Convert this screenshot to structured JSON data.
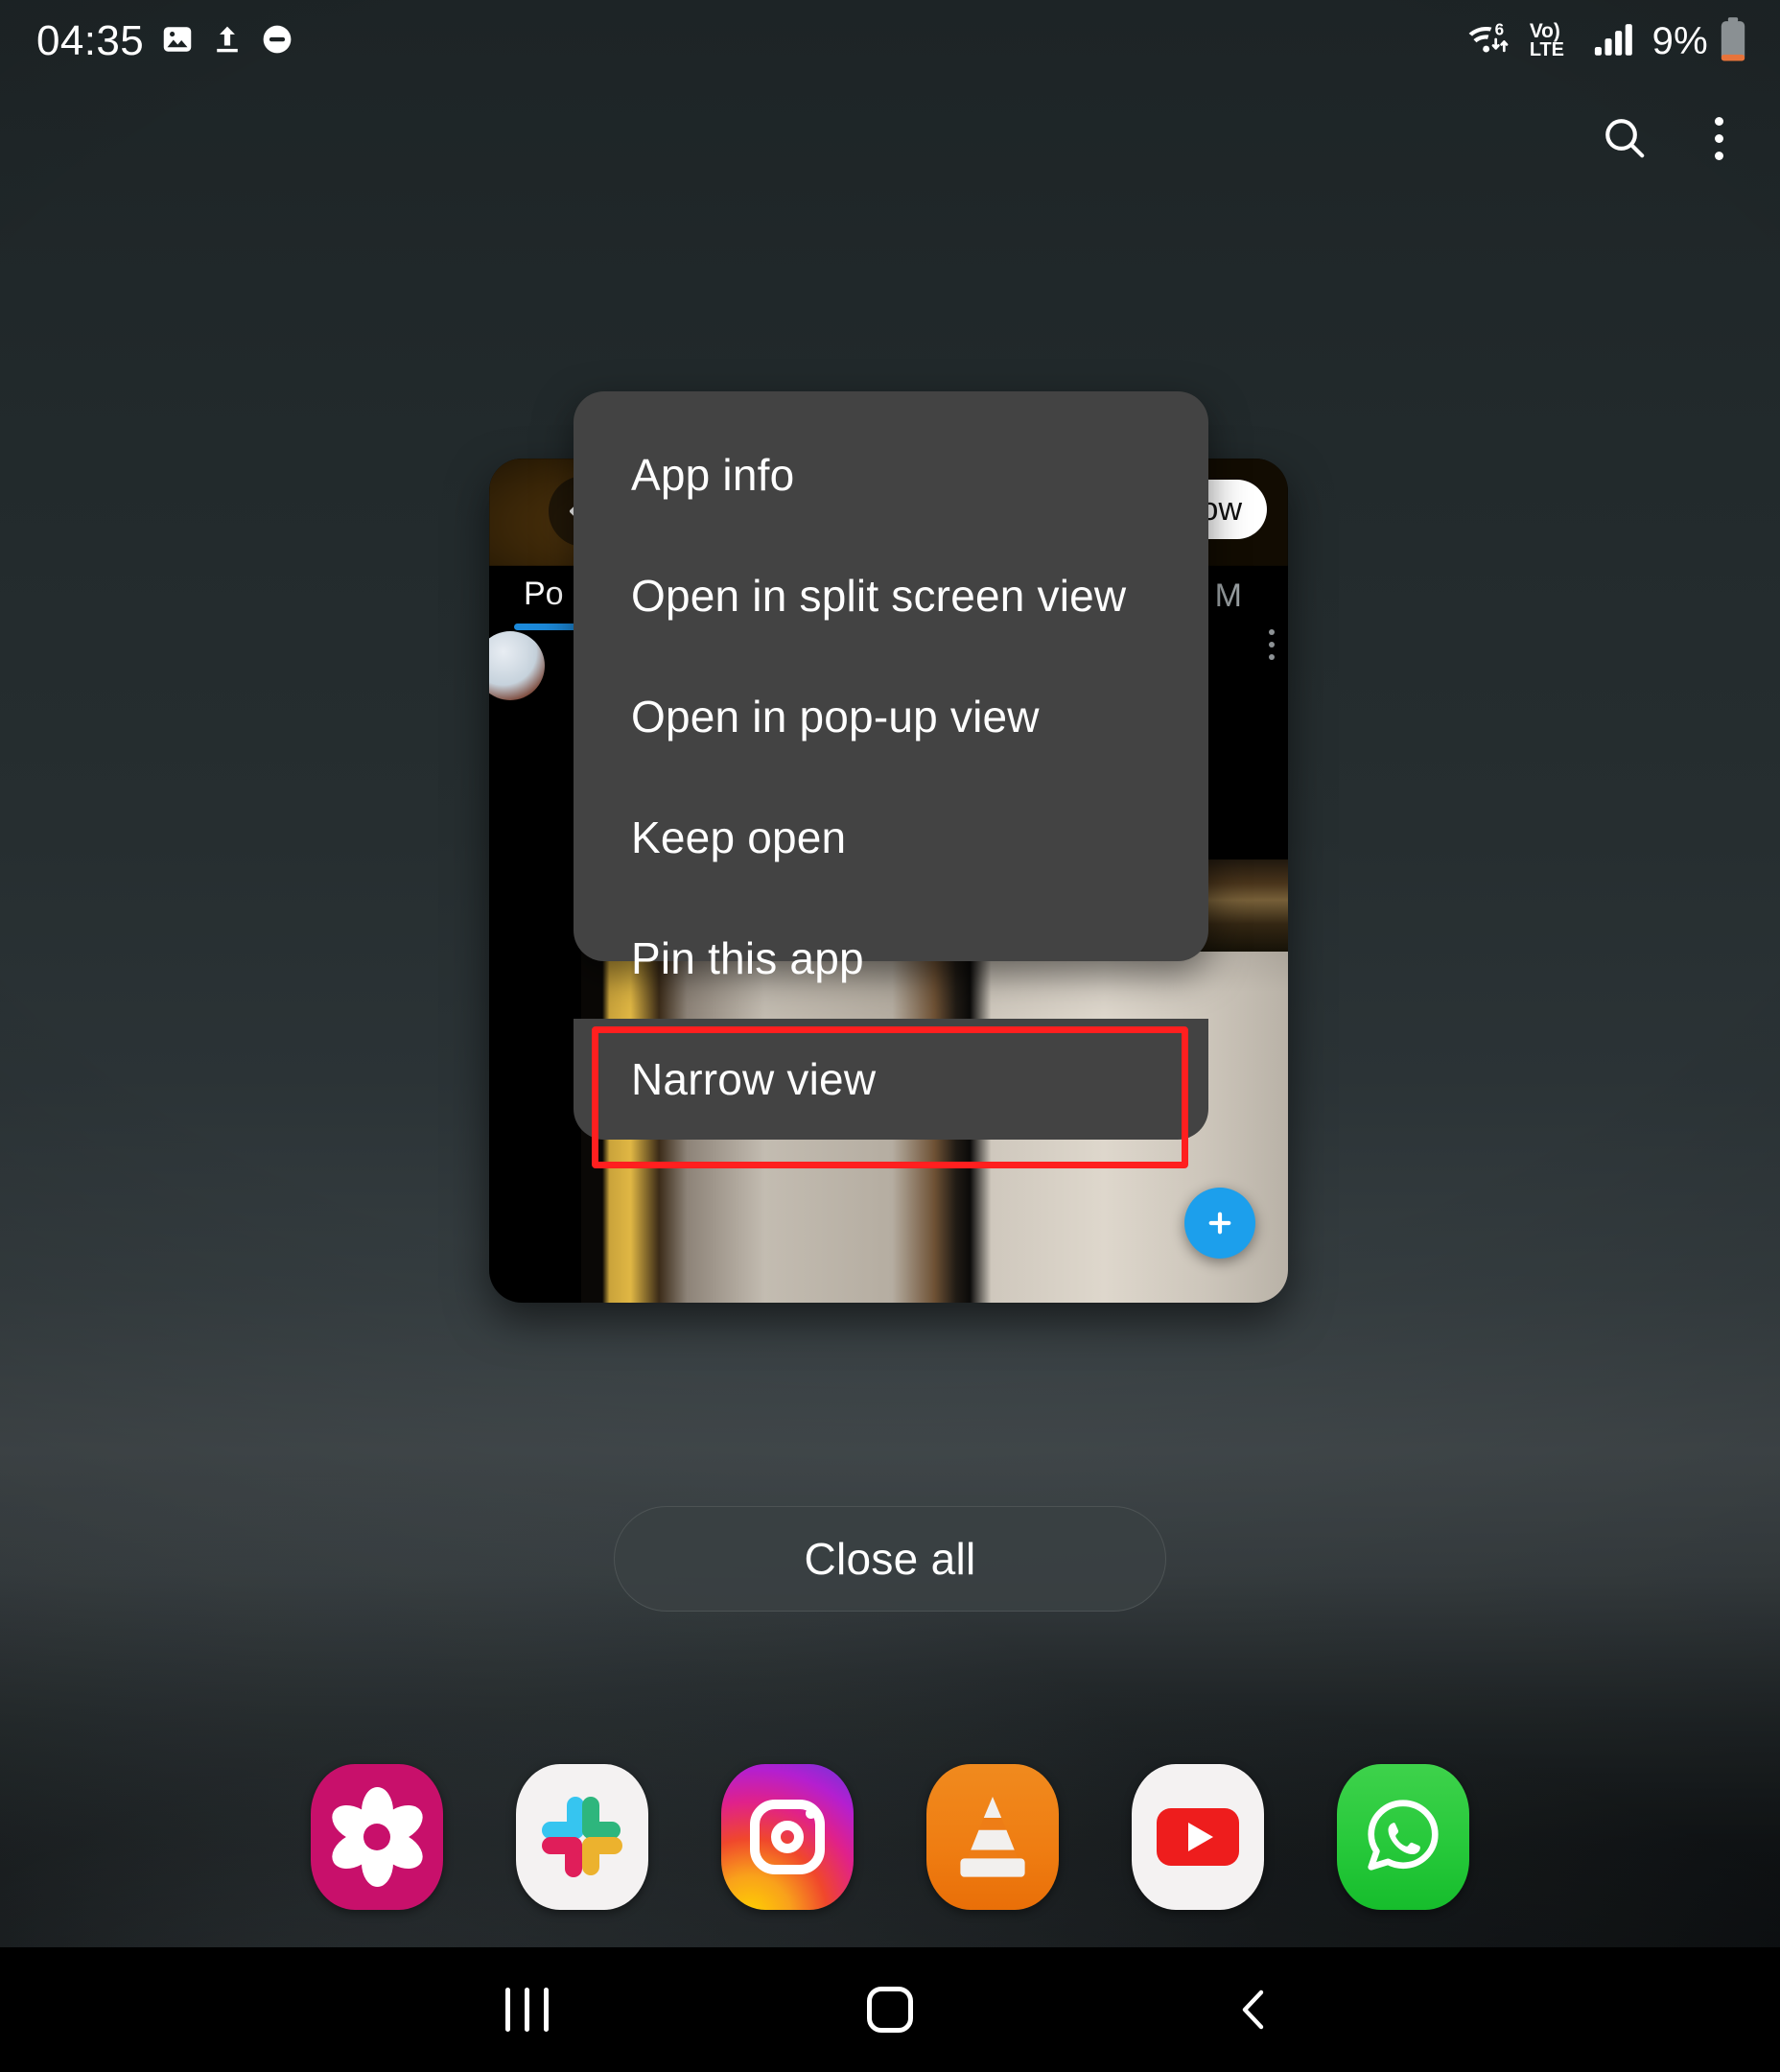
{
  "status_bar": {
    "time": "04:35",
    "battery_percent": "9%",
    "left_icons": [
      "image-icon",
      "upload-icon",
      "do-not-disturb-icon"
    ],
    "right_icons": [
      "wifi-6-icon",
      "volte-icon",
      "signal-bars-icon",
      "battery-icon"
    ],
    "wifi_label": "6",
    "volte_top": "Vo)",
    "volte_bottom": "LTE",
    "battery_color": "#e8743b"
  },
  "top_actions": {
    "search_icon": "search-icon",
    "overflow_icon": "more-vertical-icon"
  },
  "recents": {
    "close_all_label": "Close all",
    "app_card": {
      "back_icon": "arrow-left-icon",
      "follow_button_label": "ow",
      "tab_posts_label": "Po",
      "tab_more_label": "M",
      "overflow_icon": "more-vertical-icon",
      "fab_icon": "plus-icon",
      "accent_color": "#1c8adb",
      "fab_color": "#1c9fec"
    }
  },
  "popup_menu": {
    "items": [
      {
        "label": "App info",
        "name": "menu-item-app-info"
      },
      {
        "label": "Open in split screen view",
        "name": "menu-item-split-screen"
      },
      {
        "label": "Open in pop-up view",
        "name": "menu-item-popup-view"
      },
      {
        "label": "Keep open",
        "name": "menu-item-keep-open"
      },
      {
        "label": "Pin this app",
        "name": "menu-item-pin-app"
      },
      {
        "label": "Narrow view",
        "name": "menu-item-narrow-view"
      }
    ],
    "background_color": "#434343",
    "highlighted_item": "Narrow view",
    "highlight_color": "#ff1f1f"
  },
  "dock": {
    "apps": [
      {
        "name": "gallery",
        "icon": "gallery-flower-icon",
        "color": "#c8106b"
      },
      {
        "name": "slack",
        "icon": "slack-hash-icon",
        "color": "#f4f2f2"
      },
      {
        "name": "instagram",
        "icon": "instagram-camera-icon",
        "color": "#e0218a"
      },
      {
        "name": "vlc",
        "icon": "vlc-cone-icon",
        "color": "#ef7d12"
      },
      {
        "name": "youtube",
        "icon": "youtube-play-icon",
        "color": "#ee1d1d"
      },
      {
        "name": "whatsapp",
        "icon": "whatsapp-phone-icon",
        "color": "#27c93b"
      }
    ]
  },
  "nav_bar": {
    "recents_icon": "recents-icon",
    "home_icon": "home-icon",
    "back_icon": "back-chevron-icon"
  }
}
